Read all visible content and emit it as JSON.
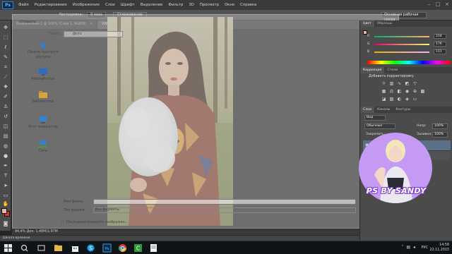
{
  "menubar": {
    "logo": "Ps",
    "items": [
      "Файл",
      "Редактирование",
      "Изображение",
      "Слои",
      "Шрифт",
      "Выделение",
      "Фильтр",
      "3D",
      "Просмотр",
      "Окно",
      "Справка"
    ]
  },
  "options": {
    "feather_label": "Растушевка:",
    "feather_value": "0 пикс",
    "smoothing_label": "Сглаживание",
    "workspace": "Основная рабочая среда"
  },
  "doc_tabs": [
    {
      "label": "Безымянный-1 @ 100% (Слой 1, RGB/8)",
      "close": "×"
    },
    {
      "label": "VWK5yPt87oM.jpg @ 94,4% (Слой 1, RGB/8#)",
      "close": "×",
      "active": true
    }
  ],
  "dialog": {
    "title": "Открыть",
    "folder_label": "Папка:",
    "folder_value": "фото",
    "places": [
      "Панель быстрого доступа",
      "Рабочий стол",
      "Библиотеки",
      "Этот компьютер",
      "Сеть"
    ],
    "filename_label": "Имя файла:",
    "filetype_label": "Тип файлов:",
    "filetype_value": "Все форматы",
    "sequence_label": "Последовательность изображен..."
  },
  "status": {
    "zoom_doc": "94,4%   Док: 1,48M/2,97M",
    "timeline": "Шкала времени"
  },
  "color_panel": {
    "tabs": [
      "Цвет",
      "Образцы"
    ],
    "channels": [
      {
        "name": "R",
        "value": "234"
      },
      {
        "name": "G",
        "value": "176"
      },
      {
        "name": "B",
        "value": "111"
      }
    ]
  },
  "adjustments": {
    "tabs": [
      "Коррекция",
      "Стили"
    ],
    "title": "Добавить корректировку"
  },
  "layers_panel": {
    "tabs": [
      "Слои",
      "Каналы",
      "Контуры"
    ],
    "kind": "Вид",
    "blend": "Обычные",
    "opacity_label": "Непр:",
    "opacity_value": "100%",
    "lock_label": "Закрепить:",
    "fill_label": "Заливка:",
    "fill_value": "100%"
  },
  "watermark": {
    "text": "PS BY SANDY"
  },
  "taskbar": {
    "lang": "РУС",
    "time": "14:58",
    "date": "22.11.2015"
  },
  "colors": {
    "foreground": "#f1b5a6",
    "background": "#d9322a",
    "watermark_circle": "#c59af5",
    "active_layer": "#5a6f88"
  }
}
